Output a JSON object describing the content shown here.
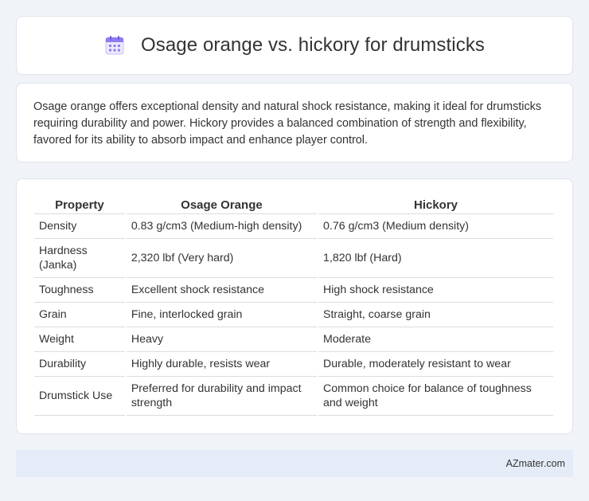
{
  "header": {
    "title": "Osage orange vs. hickory for drumsticks",
    "icon": "calendar-icon",
    "icon_color": "#8e7cf0"
  },
  "summary": "Osage orange offers exceptional density and natural shock resistance, making it ideal for drumsticks requiring durability and power. Hickory provides a balanced combination of strength and flexibility, favored for its ability to absorb impact and enhance player control.",
  "table": {
    "headers": [
      "Property",
      "Osage Orange",
      "Hickory"
    ],
    "rows": [
      [
        "Density",
        "0.83 g/cm3 (Medium-high density)",
        "0.76 g/cm3 (Medium density)"
      ],
      [
        "Hardness (Janka)",
        "2,320 lbf (Very hard)",
        "1,820 lbf (Hard)"
      ],
      [
        "Toughness",
        "Excellent shock resistance",
        "High shock resistance"
      ],
      [
        "Grain",
        "Fine, interlocked grain",
        "Straight, coarse grain"
      ],
      [
        "Weight",
        "Heavy",
        "Moderate"
      ],
      [
        "Durability",
        "Highly durable, resists wear",
        "Durable, moderately resistant to wear"
      ],
      [
        "Drumstick Use",
        "Preferred for durability and impact strength",
        "Common choice for balance of toughness and weight"
      ]
    ]
  },
  "footer": {
    "brand": "AZmater.com"
  }
}
